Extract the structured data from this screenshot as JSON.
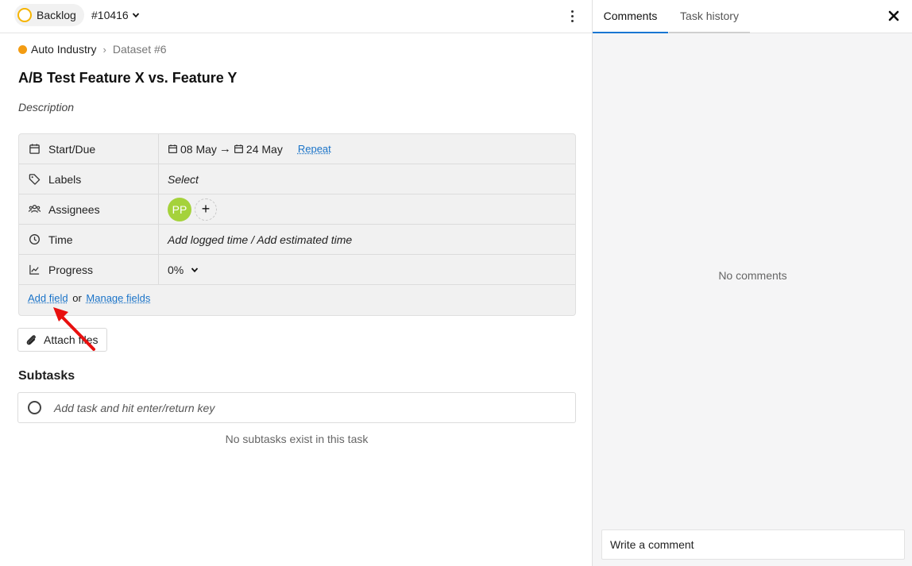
{
  "header": {
    "status_label": "Backlog",
    "task_id": "#10416"
  },
  "breadcrumb": {
    "project": "Auto Industry",
    "dataset": "Dataset #6",
    "project_color": "#f39c12"
  },
  "task": {
    "title": "A/B Test Feature X vs. Feature Y",
    "description_placeholder": "Description"
  },
  "fields": {
    "start_due": {
      "label": "Start/Due",
      "start": "08 May",
      "arrow": "→",
      "due": "24 May",
      "repeat": "Repeat"
    },
    "labels": {
      "label": "Labels",
      "value": "Select"
    },
    "assignees": {
      "label": "Assignees",
      "avatar_initials": "PP",
      "add": "+"
    },
    "time": {
      "label": "Time",
      "value": "Add logged time / Add estimated time"
    },
    "progress": {
      "label": "Progress",
      "value": "0%"
    },
    "add_field": "Add field",
    "or": "or",
    "manage_fields": "Manage fields"
  },
  "attach_files": "Attach files",
  "subtasks": {
    "heading": "Subtasks",
    "placeholder": "Add task and hit enter/return key",
    "empty": "No subtasks exist in this task"
  },
  "panel": {
    "tabs": [
      "Comments",
      "Task history"
    ],
    "empty": "No comments",
    "comment_placeholder": "Write a comment"
  },
  "colors": {
    "status_ring": "#f6b400",
    "link": "#1a73c8",
    "active_tab": "#1976d2",
    "avatar": "#a5d23b",
    "annotation_arrow": "#e8100f"
  }
}
